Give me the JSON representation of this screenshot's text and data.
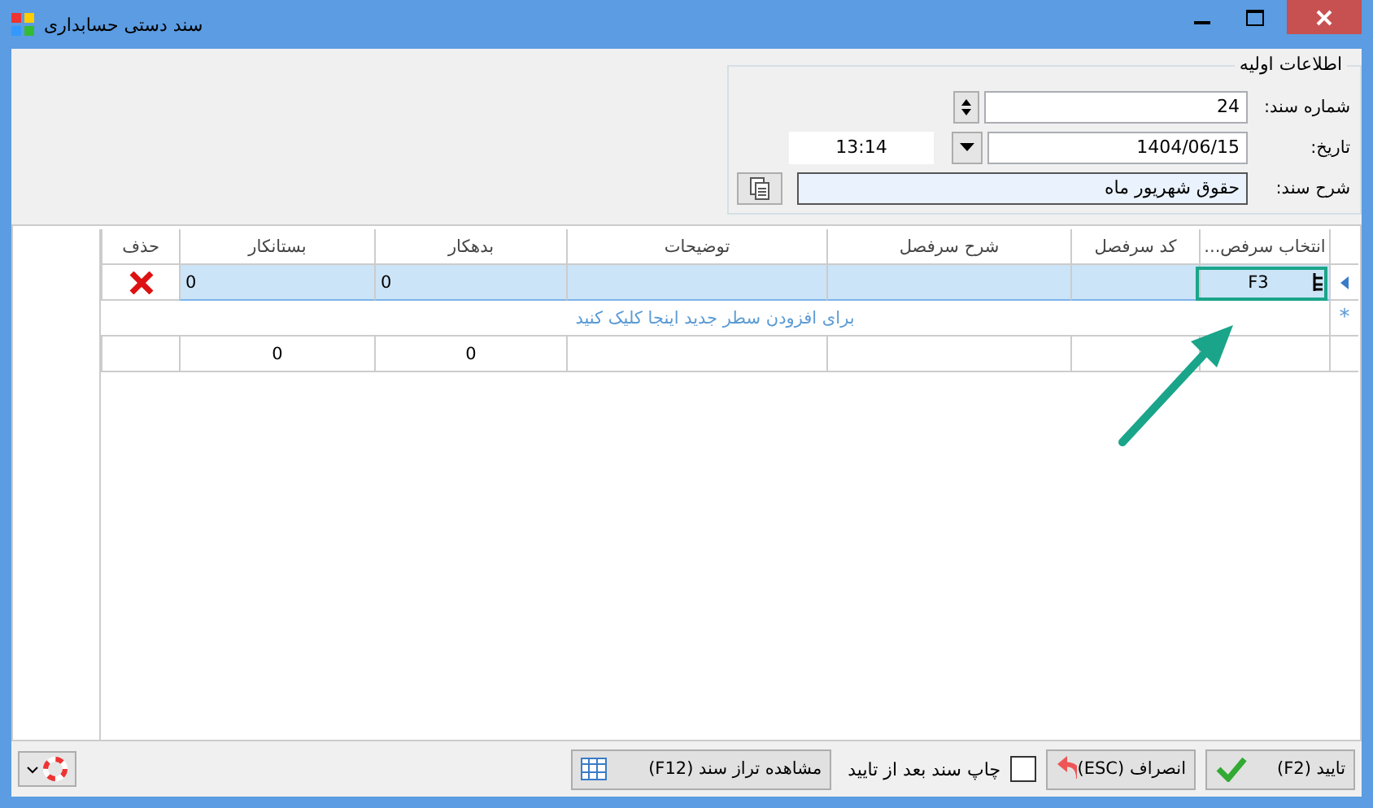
{
  "window": {
    "title": "سند دستی حسابداری"
  },
  "group": {
    "title": "اطلاعات اولیه",
    "doc_number": {
      "label": "شماره سند:",
      "value": "24"
    },
    "date": {
      "label": "تاریخ:",
      "value": "1404/06/15",
      "time": "13:14"
    },
    "description": {
      "label": "شرح سند:",
      "value": "حقوق شهریور ماه"
    }
  },
  "table": {
    "columns": [
      "انتخاب سرفص...",
      "کد سرفصل",
      "شرح سرفصل",
      "توضیحات",
      "بدهکار",
      "بستانکار",
      "حذف"
    ],
    "rows": [
      {
        "selected": true,
        "account_select": "F3",
        "debit": "0",
        "credit": "0"
      }
    ],
    "new_row": {
      "marker": "*",
      "text": "برای افزودن سطر جدید اینجا کلیک کنید"
    },
    "totals": {
      "debit": "0",
      "credit": "0"
    }
  },
  "footer": {
    "confirm": "تایید (F2)",
    "cancel": "انصراف (ESC)",
    "print_after": {
      "label": "چاپ سند بعد از تایید",
      "checked": false
    },
    "balance": "مشاهده تراز سند (F12)"
  }
}
